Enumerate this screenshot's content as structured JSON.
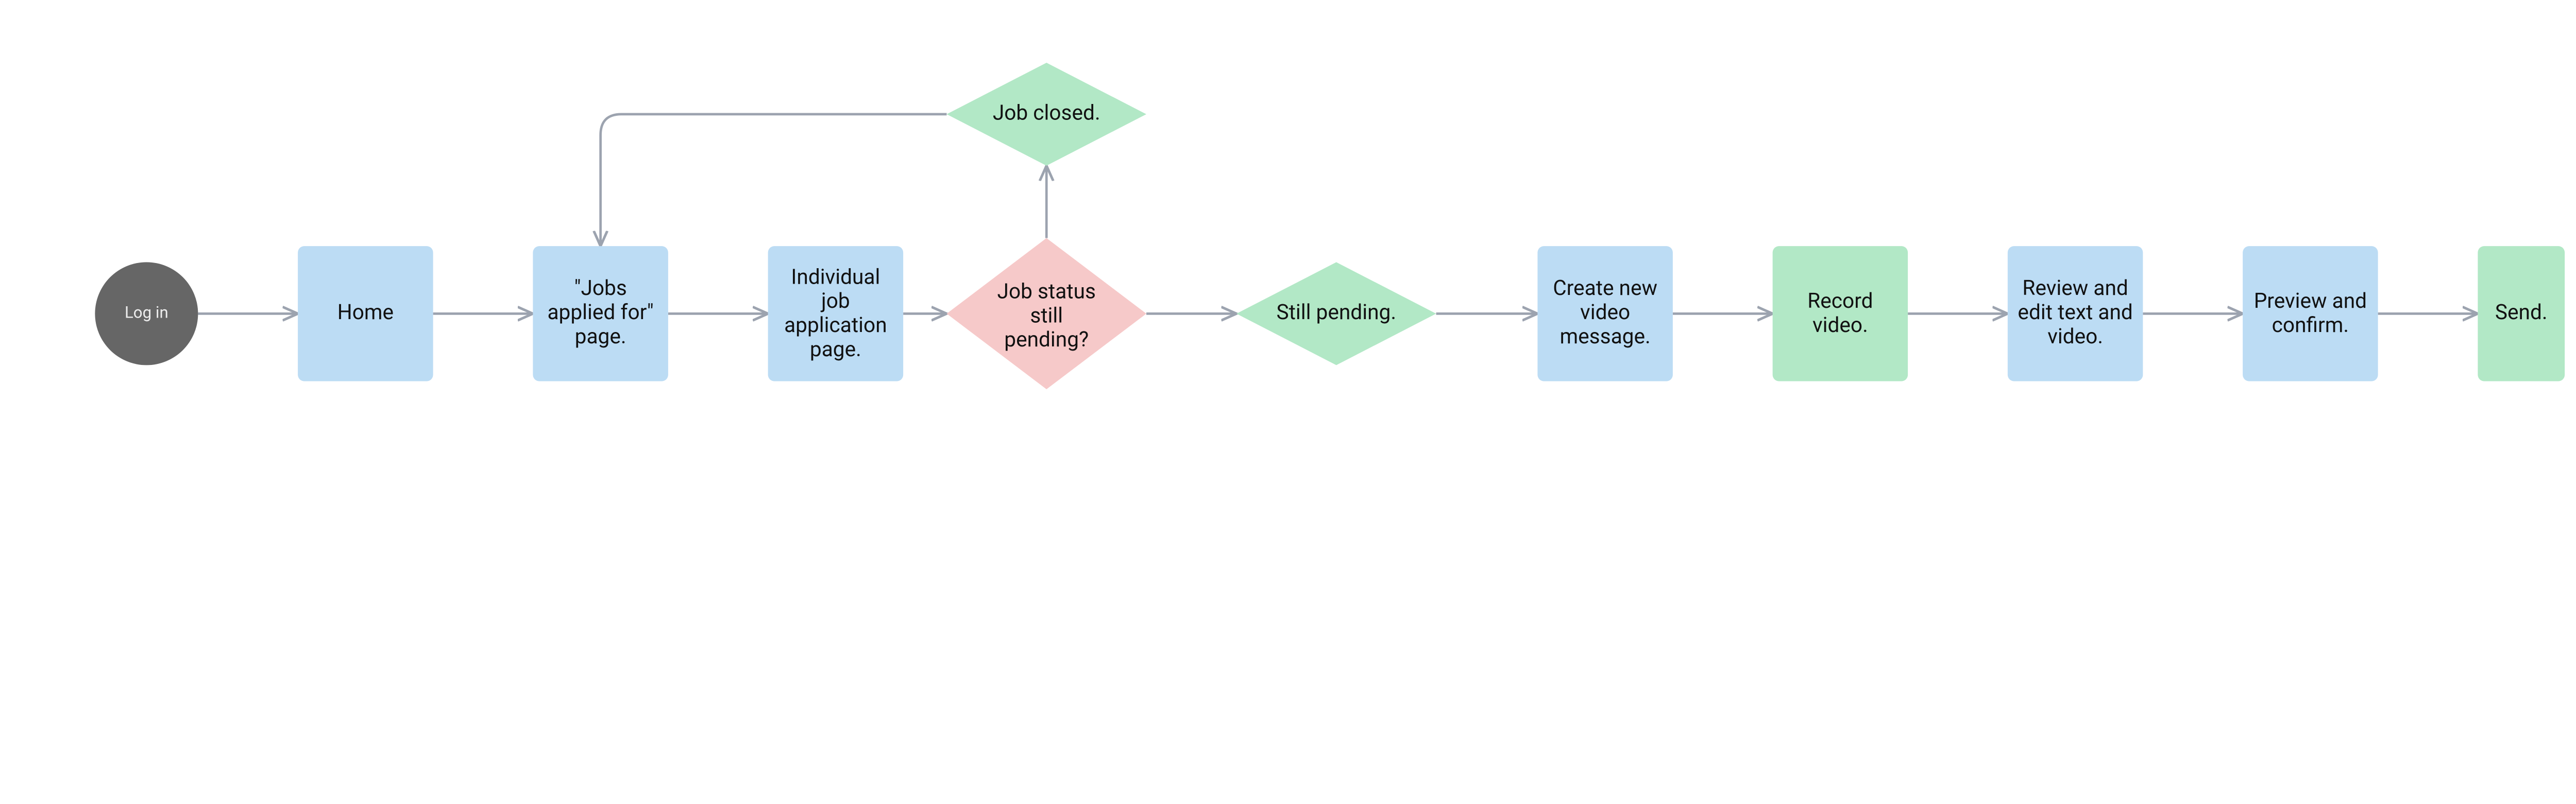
{
  "colors": {
    "terminal": "#666666",
    "process_blue": "#bcdcf4",
    "process_green": "#b2e8c6",
    "decision_pink": "#f6c9c9",
    "decision_green": "#b2e8c6",
    "arrow": "#9ca3af"
  },
  "nodes": {
    "login": {
      "type": "terminal",
      "label": "Log in"
    },
    "home": {
      "type": "process",
      "label": "Home"
    },
    "jobs_page": {
      "type": "process",
      "line1": "\"Jobs",
      "line2": "applied for\"",
      "line3": "page."
    },
    "individual": {
      "type": "process",
      "line1": "Individual",
      "line2": "job",
      "line3": "application",
      "line4": "page."
    },
    "status_q": {
      "type": "decision",
      "line1": "Job status",
      "line2": "still",
      "line3": "pending?"
    },
    "job_closed": {
      "type": "decision",
      "label": "Job closed."
    },
    "still_pending": {
      "type": "decision",
      "label": "Still pending."
    },
    "create_msg": {
      "type": "process",
      "line1": "Create new",
      "line2": "video",
      "line3": "message."
    },
    "record": {
      "type": "process",
      "line1": "Record",
      "line2": "video."
    },
    "review": {
      "type": "process",
      "line1": "Review and",
      "line2": "edit text and",
      "line3": "video."
    },
    "preview": {
      "type": "process",
      "line1": "Preview and",
      "line2": "confirm."
    },
    "send": {
      "type": "process",
      "label": "Send."
    }
  },
  "edges": [
    {
      "from": "login",
      "to": "home"
    },
    {
      "from": "home",
      "to": "jobs_page"
    },
    {
      "from": "jobs_page",
      "to": "individual"
    },
    {
      "from": "individual",
      "to": "status_q"
    },
    {
      "from": "status_q",
      "to": "job_closed"
    },
    {
      "from": "status_q",
      "to": "still_pending"
    },
    {
      "from": "job_closed",
      "to": "jobs_page"
    },
    {
      "from": "still_pending",
      "to": "create_msg"
    },
    {
      "from": "create_msg",
      "to": "record"
    },
    {
      "from": "record",
      "to": "review"
    },
    {
      "from": "review",
      "to": "preview"
    },
    {
      "from": "preview",
      "to": "send"
    }
  ]
}
